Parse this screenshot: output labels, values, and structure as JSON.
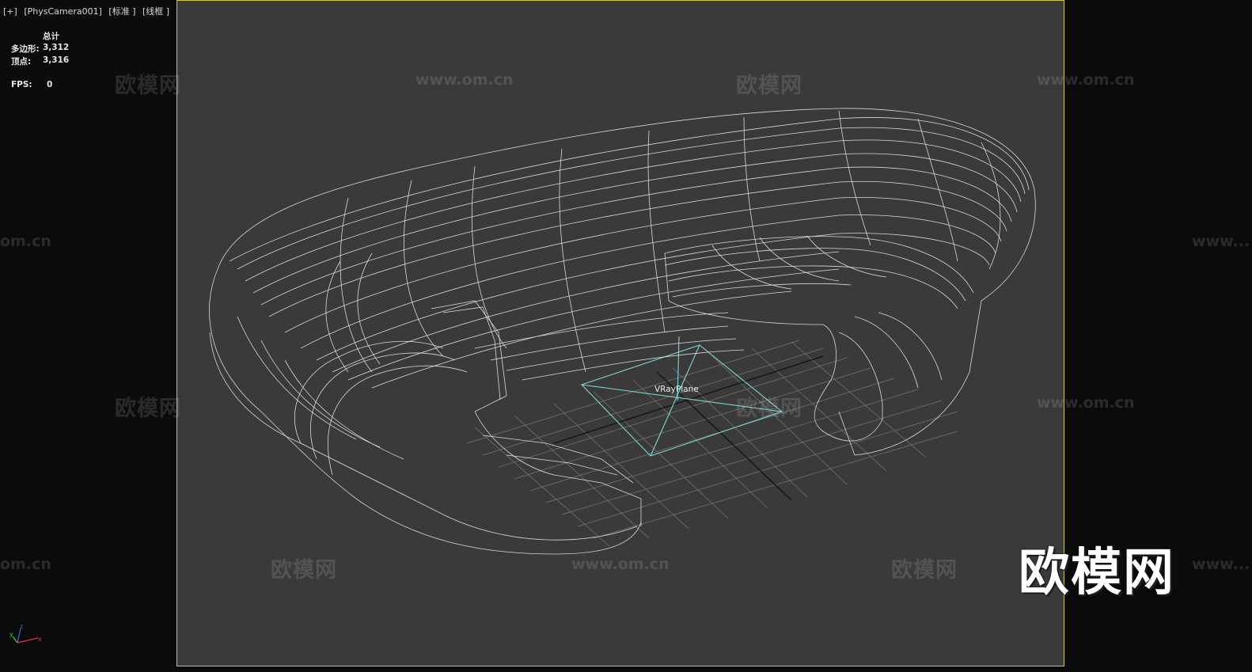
{
  "viewport": {
    "label_parts": [
      "[+]",
      "[PhysCamera001]",
      "[标准 ]",
      "[线框 ]"
    ]
  },
  "stats": {
    "header": "总计",
    "polygons_label": "多边形:",
    "polygons_value": "3,312",
    "vertices_label": "顶点:",
    "vertices_value": "3,316",
    "fps_label": "FPS:",
    "fps_value": "0"
  },
  "scene": {
    "object_label": "VRayPlane",
    "wireframe_color": "#e6e6e6",
    "plane_color": "#7fd6d6",
    "grid_color": "#9a9a9a",
    "frame_border_color": "#c9c64a"
  },
  "watermarks": {
    "cn_text": "欧模网",
    "url_text": "www.om.cn",
    "url_short": "om.cn",
    "url_cut": "www..."
  },
  "logo": {
    "text": "欧模网"
  },
  "axis_labels": {
    "x": "x",
    "y": "y",
    "z": "z"
  }
}
